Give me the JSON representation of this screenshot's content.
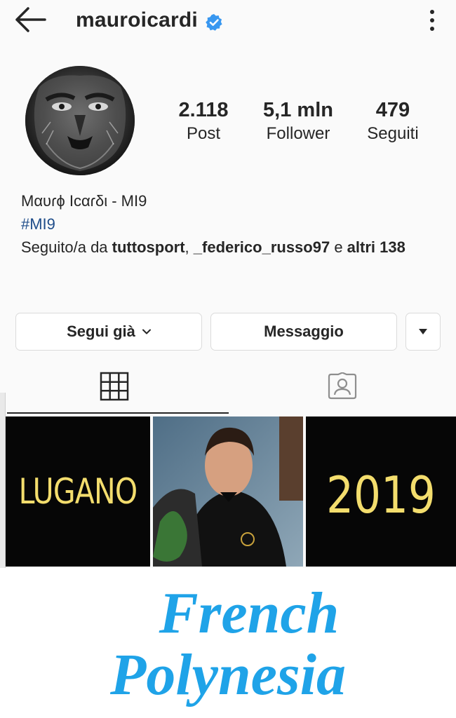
{
  "header": {
    "username": "mauroicardi",
    "back_icon": "arrow-left-icon",
    "verified_icon": "verified-badge-icon",
    "more_icon": "more-vertical-icon"
  },
  "stats": {
    "posts": {
      "value": "2.118",
      "label": "Post"
    },
    "followers": {
      "value": "5,1 mln",
      "label": "Follower"
    },
    "following": {
      "value": "479",
      "label": "Seguiti"
    }
  },
  "bio": {
    "name": "Mαυɾϕ Iϲαɾδι - MI9",
    "hashtag": "#MI9",
    "followed_prefix": "Seguito/a da ",
    "followed_user1": "tuttosport",
    "followed_sep": ", ",
    "followed_user2": "_federico_russo97",
    "followed_and": " e ",
    "followed_others": "altri 138"
  },
  "buttons": {
    "following": "Segui già",
    "message": "Messaggio"
  },
  "tabs": {
    "grid_icon": "grid-icon",
    "tagged_icon": "tagged-person-icon"
  },
  "posts": [
    {
      "text": "LUGANO"
    },
    {
      "text": ""
    },
    {
      "text": "2019"
    }
  ],
  "overlay": {
    "line1": "French",
    "line2": "Polynesia"
  },
  "colors": {
    "verified": "#3897f0",
    "hashtag": "#1f4d8a",
    "post_text": "#f3dd6d",
    "overlay_text": "#1fa3e8"
  }
}
